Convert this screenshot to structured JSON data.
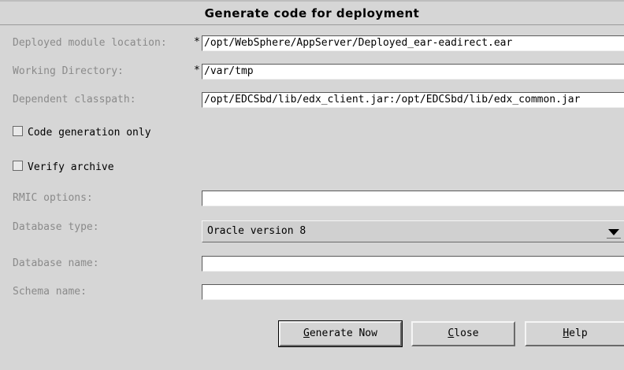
{
  "dialog": {
    "title": "Generate code for deployment"
  },
  "fields": {
    "deployed_module": {
      "label": "Deployed module location:",
      "required_mark": "*",
      "value": "/opt/WebSphere/AppServer/Deployed_ear-eadirect.ear"
    },
    "working_directory": {
      "label": "Working Directory:",
      "required_mark": "*",
      "value": "/var/tmp"
    },
    "dependent_classpath": {
      "label": "Dependent classpath:",
      "value": "/opt/EDCSbd/lib/edx_client.jar:/opt/EDCSbd/lib/edx_common.jar"
    },
    "rmic_options": {
      "label": "RMIC options:",
      "value": ""
    },
    "database_type": {
      "label": "Database type:",
      "value": "Oracle version 8"
    },
    "database_name": {
      "label": "Database name:",
      "value": ""
    },
    "schema_name": {
      "label": "Schema name:",
      "value": ""
    }
  },
  "checkboxes": {
    "code_generation_only": {
      "label": "Code generation only",
      "checked": false
    },
    "verify_archive": {
      "label": "Verify archive",
      "checked": false
    }
  },
  "buttons": {
    "generate": {
      "mnemonic": "G",
      "rest": "enerate Now"
    },
    "close": {
      "mnemonic": "C",
      "rest": "lose"
    },
    "help": {
      "mnemonic": "H",
      "rest": "elp"
    }
  }
}
